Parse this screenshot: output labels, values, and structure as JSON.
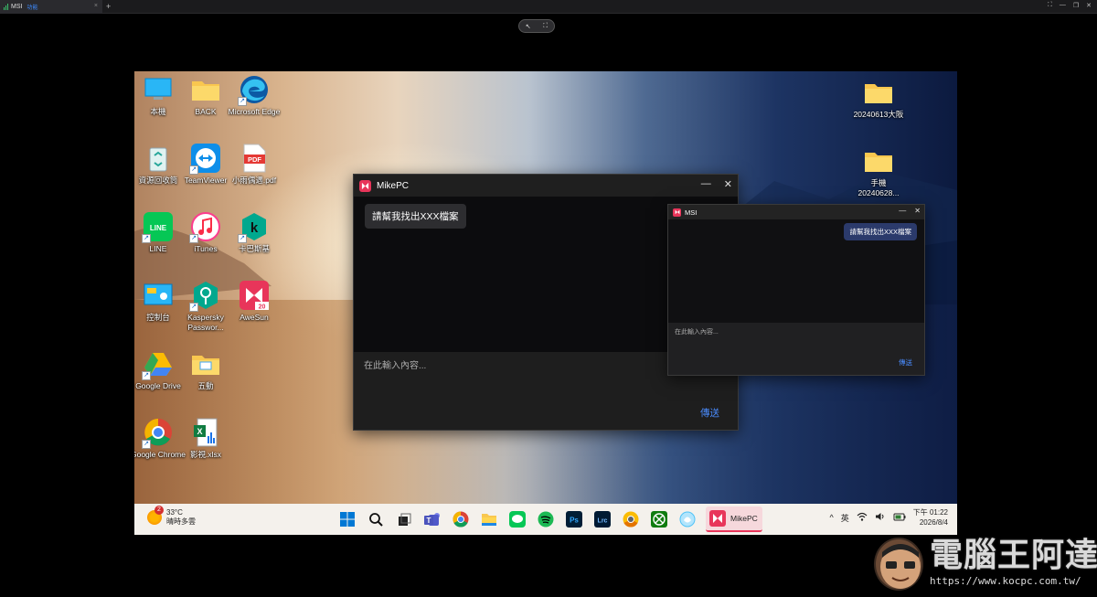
{
  "viewer": {
    "tab_title": "MSI",
    "tab_subtitle": "功能",
    "tab_close": "×",
    "new_tab": "+",
    "win_buttons": [
      "⛶",
      "—",
      "❐",
      "✕"
    ],
    "float_controls": [
      "↖",
      "⛶"
    ]
  },
  "desktop": {
    "icons": [
      {
        "label": "本機"
      },
      {
        "label": "BACK"
      },
      {
        "label": "Microsoft Edge"
      },
      {
        "label": "資源回收筒"
      },
      {
        "label": "TeamViewer"
      },
      {
        "label": "小雨偶遇.pdf"
      },
      {
        "label": "LINE"
      },
      {
        "label": "iTunes"
      },
      {
        "label": "卡巴斯基"
      },
      {
        "label": "控制台"
      },
      {
        "label": "Kaspersky Passwor..."
      },
      {
        "label": "AweSun"
      },
      {
        "label": "Google Drive"
      },
      {
        "label": "五動"
      },
      {
        "label": "Google Chrome"
      },
      {
        "label": "影視.xlsx"
      },
      {
        "label": "20240613大阪"
      },
      {
        "label": "手機 20240628..."
      }
    ],
    "pdf_badge": "PDF",
    "line_badge": "LINE",
    "kas_badge": "k",
    "awesun_badge": "20"
  },
  "main_window": {
    "title": "MikePC",
    "minimize": "—",
    "close": "✕",
    "message": "請幫我找出XXX檔案",
    "placeholder": "在此輸入內容...",
    "send_label": "傳送"
  },
  "msi_window": {
    "title": "MSI",
    "minimize": "—",
    "close": "✕",
    "message": "請幫我找出XXX檔案",
    "placeholder": "在此輸入內容...",
    "send_label": "傳送"
  },
  "taskbar": {
    "weather_temp": "33°C",
    "weather_desc": "晴時多雲",
    "weather_badge": "2",
    "active_app_label": "MikePC",
    "ime": "英",
    "tray_chevron": "^",
    "time": "下午 01:22",
    "date": "2026/8/4",
    "app_icons": [
      "start-icon",
      "search-icon",
      "task-view-icon",
      "teams-icon",
      "chrome-icon",
      "file-explorer-icon",
      "line-icon",
      "spotify-icon",
      "photoshop-icon",
      "lightroom-icon",
      "chrome-canary-icon",
      "xbox-icon",
      "remote-icon"
    ],
    "ps_text": "Ps",
    "lrc_text": "Lrc"
  },
  "watermark": {
    "brand": "電腦王阿達",
    "url": "https://www.kocpc.com.tw/"
  }
}
